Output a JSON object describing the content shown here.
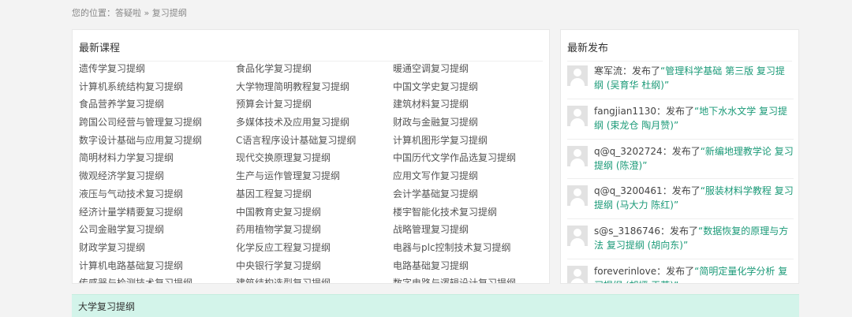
{
  "breadcrumb": {
    "prefix": "您的位置：",
    "home": "答疑啦",
    "separator": " » ",
    "current": "复习提纲"
  },
  "courses": {
    "title": "最新课程",
    "items": [
      "遗传学复习提纲",
      "食品化学复习提纲",
      "暖通空调复习提纲",
      "计算机系统结构复习提纲",
      "大学物理简明教程复习提纲",
      "中国文学史复习提纲",
      "食品营养学复习提纲",
      "预算会计复习提纲",
      "建筑材料复习提纲",
      "跨国公司经营与管理复习提纲",
      "多媒体技术及应用复习提纲",
      "财政与金融复习提纲",
      "数字设计基础与应用复习提纲",
      "C语言程序设计基础复习提纲",
      "计算机图形学复习提纲",
      "简明材料力学复习提纲",
      "现代交换原理复习提纲",
      "中国历代文学作品选复习提纲",
      "微观经济学复习提纲",
      "生产与运作管理复习提纲",
      "应用文写作复习提纲",
      "液压与气动技术复习提纲",
      "基因工程复习提纲",
      "会计学基础复习提纲",
      "经济计量学精要复习提纲",
      "中国教育史复习提纲",
      "楼宇智能化技术复习提纲",
      "公司金融学复习提纲",
      "药用植物学复习提纲",
      "战略管理复习提纲",
      "财政学复习提纲",
      "化学反应工程复习提纲",
      "电器与plc控制技术复习提纲",
      "计算机电路基础复习提纲",
      "中央银行学复习提纲",
      "电路基础复习提纲",
      "传感器与检测技术复习提纲",
      "建筑结构选型复习提纲",
      "数字电路与逻辑设计复习提纲"
    ]
  },
  "news": {
    "title": "最新发布",
    "published_label": "：发布了",
    "open_quote": "“",
    "close_quote": "”",
    "items": [
      {
        "user": "寒军流",
        "link": "管理科学基础 第三版 复习提纲 (吴育华 杜纲)"
      },
      {
        "user": "fangjian1130",
        "link": "地下水水文学 复习提纲 (束龙仓 陶月赞)"
      },
      {
        "user": "q@q_3202724",
        "link": "新编地理教学论 复习提纲 (陈澄)"
      },
      {
        "user": "q@q_3200461",
        "link": "服装材料学教程 复习提纲 (马大力 陈红)"
      },
      {
        "user": "s@s_3186746",
        "link": "数据恢复的原理与方法 复习提纲 (胡向东)"
      },
      {
        "user": "foreverinlove",
        "link": "简明定量化学分析 复习提纲 (胡坪 王芳)"
      }
    ]
  },
  "section": {
    "title": "大学复习提纲"
  },
  "colors": {
    "link_green": "#1b9a78",
    "section_bg": "#d3f4ea"
  }
}
